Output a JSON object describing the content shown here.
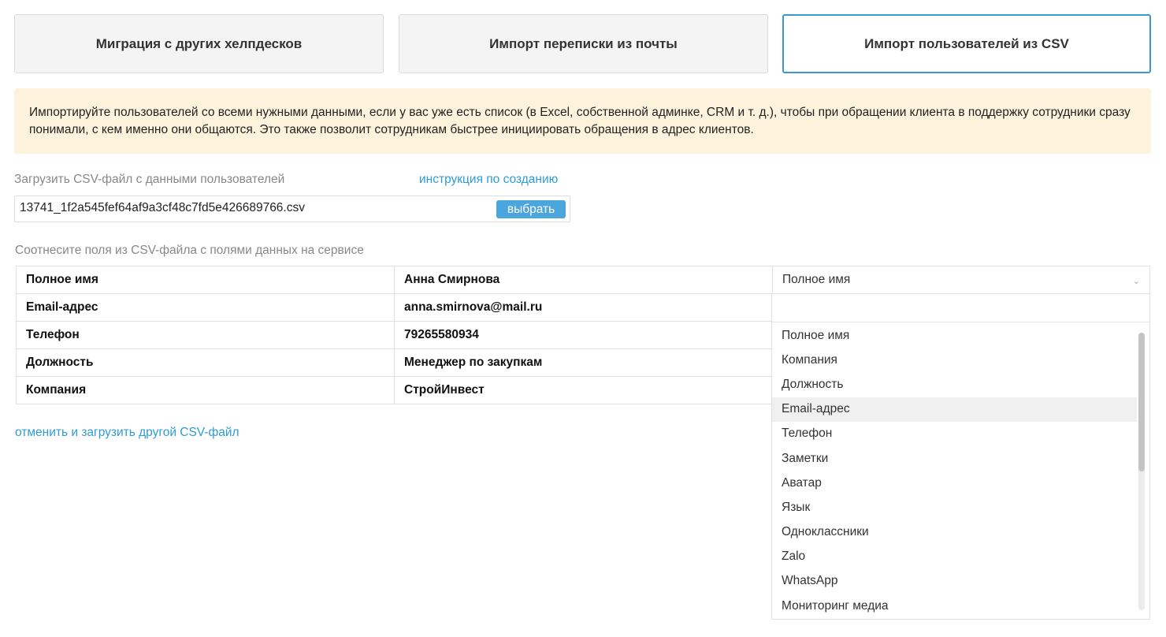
{
  "tabs": [
    {
      "label": "Миграция с других хелпдесков"
    },
    {
      "label": "Импорт переписки из почты"
    },
    {
      "label": "Импорт пользователей из CSV"
    }
  ],
  "notice": {
    "text": "Импортируйте пользователей со всеми нужными данными, если у вас уже есть список (в Excel, собственной админке, CRM и т. д.), чтобы при обращении клиента в поддержку сотрудники сразу понимали, с кем именно они общаются. Это также позволит сотрудникам быстрее инициировать обращения в адрес клиентов."
  },
  "upload": {
    "label": "Загрузить CSV-файл с данными пользователей",
    "help_link": "инструкция по созданию",
    "file_name": "13741_1f2a545fef64af9a3cf48c7fd5e426689766.csv",
    "choose_label": "выбрать"
  },
  "mapping": {
    "label": "Соотнесите поля из CSV-файла с полями данных на сервисе",
    "rows": [
      {
        "field": "Полное имя",
        "value": "Анна Смирнова",
        "target": "Полное имя"
      },
      {
        "field": "Email-адрес",
        "value": "anna.smirnova@mail.ru",
        "target": ""
      },
      {
        "field": "Телефон",
        "value": "79265580934",
        "target": ""
      },
      {
        "field": "Должность",
        "value": "Менеджер по закупкам",
        "target": ""
      },
      {
        "field": "Компания",
        "value": "СтройИнвест",
        "target": ""
      }
    ]
  },
  "cancel_link": "отменить и загрузить другой CSV-файл",
  "dropdown": {
    "options": [
      "Полное имя",
      "Компания",
      "Должность",
      "Email-адрес",
      "Телефон",
      "Заметки",
      "Аватар",
      "Язык",
      "Одноклассники",
      "Zalo",
      "WhatsApp",
      "Мониторинг медиа"
    ],
    "highlighted": "Email-адрес"
  },
  "colors": {
    "accent": "#3a97cf",
    "link": "#2e9bd6",
    "button": "#4aa6dc",
    "notice_bg": "#fdf3dc"
  }
}
